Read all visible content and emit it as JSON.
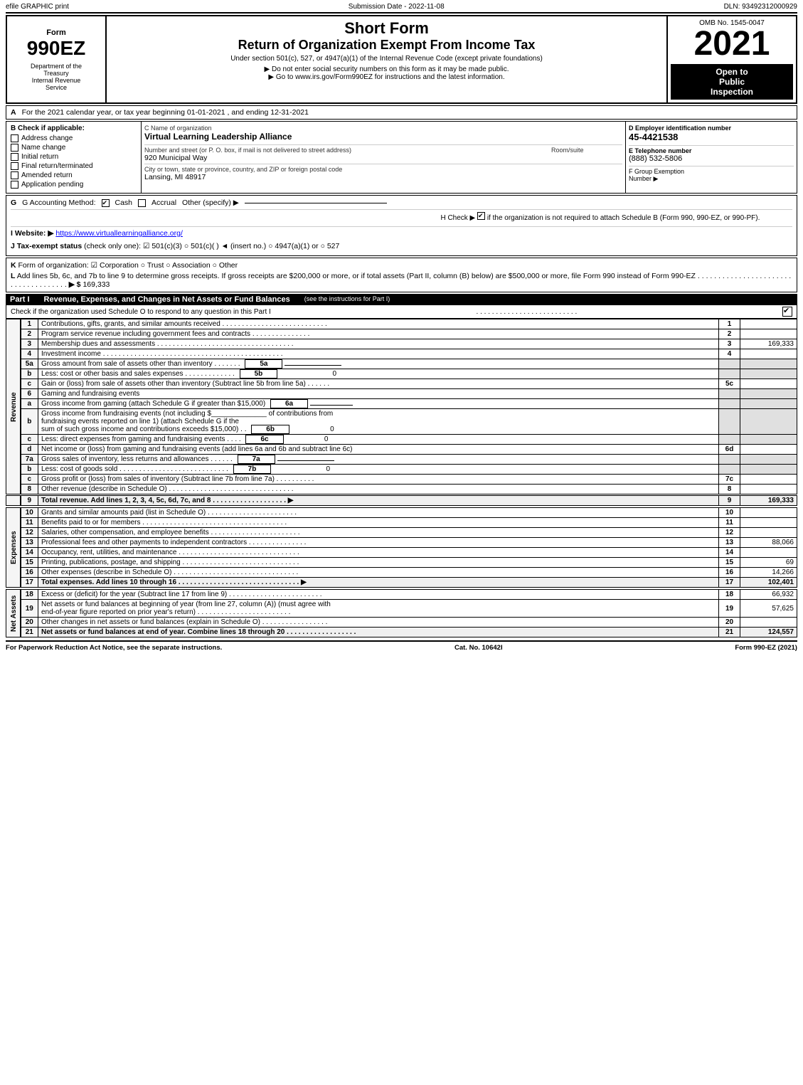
{
  "topBar": {
    "left": "efile GRAPHIC print",
    "mid": "Submission Date - 2022-11-08",
    "right": "DLN: 93492312000929"
  },
  "header": {
    "formNumber": "990EZ",
    "deptLine1": "Department of the",
    "deptLine2": "Treasury",
    "deptLine3": "Internal Revenue",
    "deptLine4": "Service",
    "shortForm": "Short Form",
    "returnTitle": "Return of Organization Exempt From Income Tax",
    "subText": "Under section 501(c), 527, or 4947(a)(1) of the Internal Revenue Code (except private foundations)",
    "noSSN": "▶ Do not enter social security numbers on this form as it may be made public.",
    "goTo": "▶ Go to www.irs.gov/Form990EZ for instructions and the latest information.",
    "ombNo": "OMB No. 1545-0047",
    "year": "2021",
    "openPublicLine1": "Open to",
    "openPublicLine2": "Public",
    "openPublicLine3": "Inspection"
  },
  "sectionA": {
    "label": "A",
    "text": "For the 2021 calendar year, or tax year beginning 01-01-2021 , and ending 12-31-2021"
  },
  "sectionB": {
    "label": "B",
    "checkTitle": "Check if applicable:",
    "items": [
      {
        "id": "address-change",
        "label": "Address change",
        "checked": false
      },
      {
        "id": "name-change",
        "label": "Name change",
        "checked": false
      },
      {
        "id": "initial-return",
        "label": "Initial return",
        "checked": false
      },
      {
        "id": "final-return",
        "label": "Final return/terminated",
        "checked": false
      },
      {
        "id": "amended-return",
        "label": "Amended return",
        "checked": false
      },
      {
        "id": "app-pending",
        "label": "Application pending",
        "checked": false
      }
    ]
  },
  "orgInfo": {
    "nameLabel": "C Name of organization",
    "name": "Virtual Learning Leadership Alliance",
    "streetLabel": "Number and street (or P. O. box, if mail is not delivered to street address)",
    "street": "920 Municipal Way",
    "roomLabel": "Room/suite",
    "room": "",
    "cityLabel": "City or town, state or province, country, and ZIP or foreign postal code",
    "city": "Lansing, MI  48917"
  },
  "taxInfo": {
    "einLabel": "D Employer identification number",
    "ein": "45-4421538",
    "phoneLabel": "E Telephone number",
    "phone": "(888) 532-5806",
    "fgroupLabel": "F Group Exemption",
    "fgroupLabel2": "Number",
    "fgroupArrow": "▶"
  },
  "accounting": {
    "gLabel": "G Accounting Method:",
    "cashLabel": "Cash",
    "cashChecked": true,
    "accrualLabel": "Accrual",
    "accrualChecked": false,
    "otherLabel": "Other (specify) ▶",
    "hLabel": "H Check ▶",
    "hText": "if the organization is not required to attach Schedule B (Form 990, 990-EZ, or 990-PF).",
    "hChecked": true,
    "iLabel": "I Website: ▶",
    "iValue": "https://www.virtuallearningalliance.org/",
    "jLabel": "J Tax-exempt status",
    "jText": "(check only one):",
    "j501c3": "✔ 501(c)(3)",
    "j501c": "○ 501(c)(   ) ◄ (insert no.)",
    "j4947": "○ 4947(a)(1) or",
    "j527": "○ 527"
  },
  "kSection": {
    "kLabel": "K",
    "kText": "Form of organization:",
    "corporation": "✔ Corporation",
    "trust": "○ Trust",
    "association": "○ Association",
    "other": "○ Other"
  },
  "lSection": {
    "lLabel": "L",
    "lText": "Add lines 5b, 6c, and 7b to line 9 to determine gross receipts. If gross receipts are $200,000 or more, or if total assets (Part II, column (B) below) are $500,000 or more, file Form 990 instead of Form 990-EZ",
    "dots": ". . . . . . . . . . . . . . . . . . . . . . . . . . . . . . . . . . . .",
    "arrow": "▶ $",
    "value": "169,333"
  },
  "partI": {
    "label": "Part I",
    "title": "Revenue, Expenses, and Changes in Net Assets or Fund Balances",
    "seeInstructions": "(see the instructions for Part I)",
    "scheduleOText": "Check if the organization used Schedule O to respond to any question in this Part I",
    "scheduleODots": ". . . . . . . . . . . . . . . . . . . . . . . . . .",
    "scheduleOChecked": true
  },
  "revenueRows": [
    {
      "num": "1",
      "desc": "Contributions, gifts, grants, and similar amounts received",
      "dots": ". . . . . . . . . . . . . . . . . . . . . . . . . . .",
      "lineNum": "1",
      "value": ""
    },
    {
      "num": "2",
      "desc": "Program service revenue including government fees and contracts",
      "dots": ". . . . . . . . . . . . . . . .",
      "lineNum": "2",
      "value": ""
    },
    {
      "num": "3",
      "desc": "Membership dues and assessments",
      "dots": ". . . . . . . . . . . . . . . . . . . . . . . . . . . . . . . . . . .",
      "lineNum": "3",
      "value": "169,333"
    },
    {
      "num": "4",
      "desc": "Investment income",
      "dots": ". . . . . . . . . . . . . . . . . . . . . . . . . . . . . . . . . . . . . . . . . . . . .",
      "lineNum": "4",
      "value": ""
    },
    {
      "num": "5a",
      "desc": "Gross amount from sale of assets other than inventory",
      "dots": ". . . . . . . .",
      "subLabel": "5a",
      "subValue": "",
      "lineNum": "",
      "value": ""
    },
    {
      "num": "b",
      "desc": "Less: cost or other basis and sales expenses",
      "dots": ". . . . . . . . . . . . .",
      "subLabel": "5b",
      "subValue": "0",
      "lineNum": "",
      "value": ""
    },
    {
      "num": "c",
      "desc": "Gain or (loss) from sale of assets other than inventory (Subtract line 5b from line 5a)",
      "dots": ". . . . . .",
      "lineNum": "5c",
      "value": ""
    },
    {
      "num": "6",
      "desc": "Gaming and fundraising events",
      "dots": "",
      "lineNum": "",
      "value": ""
    },
    {
      "num": "a",
      "desc": "Gross income from gaming (attach Schedule G if greater than $15,000)",
      "subLabel": "6a",
      "subValue": "",
      "lineNum": "",
      "value": ""
    },
    {
      "num": "b",
      "desc": "Gross income from fundraising events (not including $_____________ of contributions from fundraising events reported on line 1) (attach Schedule G if the sum of such gross income and contributions exceeds $15,000)",
      "subLabel": "6b",
      "subValue": "0",
      "lineNum": "",
      "value": ""
    },
    {
      "num": "c",
      "desc": "Less: direct expenses from gaming and fundraising events",
      "dots": ". . . .",
      "subLabel": "6c",
      "subValue": "0",
      "lineNum": "",
      "value": ""
    },
    {
      "num": "d",
      "desc": "Net income or (loss) from gaming and fundraising events (add lines 6a and 6b and subtract line 6c)",
      "dots": "",
      "lineNum": "6d",
      "value": ""
    },
    {
      "num": "7a",
      "desc": "Gross sales of inventory, less returns and allowances",
      "dots": ". . . . . .",
      "subLabel": "7a",
      "subValue": "",
      "lineNum": "",
      "value": ""
    },
    {
      "num": "b",
      "desc": "Less: cost of goods sold",
      "dots": ". . . . . . . . . . . . . . . . . . . . . . . . . . . . .",
      "subLabel": "7b",
      "subValue": "0",
      "lineNum": "",
      "value": ""
    },
    {
      "num": "c",
      "desc": "Gross profit or (loss) from sales of inventory (Subtract line 7b from line 7a)",
      "dots": ". . . . . . . . . .",
      "lineNum": "7c",
      "value": ""
    },
    {
      "num": "8",
      "desc": "Other revenue (describe in Schedule O)",
      "dots": ". . . . . . . . . . . . . . . . . . . . . . . . . . . . . . . .",
      "lineNum": "8",
      "value": ""
    },
    {
      "num": "9",
      "desc": "Total revenue. Add lines 1, 2, 3, 4, 5c, 6d, 7c, and 8",
      "dots": ". . . . . . . . . . . . . . . . . . . .",
      "arrow": "▶",
      "lineNum": "9",
      "value": "169,333",
      "bold": true
    }
  ],
  "expenseRows": [
    {
      "num": "10",
      "desc": "Grants and similar amounts paid (list in Schedule O)",
      "dots": ". . . . . . . . . . . . . . . . . . . . . . . .",
      "lineNum": "10",
      "value": ""
    },
    {
      "num": "11",
      "desc": "Benefits paid to or for members",
      "dots": ". . . . . . . . . . . . . . . . . . . . . . . . . . . . . . . . . . . . .",
      "lineNum": "11",
      "value": ""
    },
    {
      "num": "12",
      "desc": "Salaries, other compensation, and employee benefits",
      "dots": ". . . . . . . . . . . . . . . . . . . . . . . .",
      "lineNum": "12",
      "value": ""
    },
    {
      "num": "13",
      "desc": "Professional fees and other payments to independent contractors",
      "dots": ". . . . . . . . . . . . . . .",
      "lineNum": "13",
      "value": "88,066"
    },
    {
      "num": "14",
      "desc": "Occupancy, rent, utilities, and maintenance",
      "dots": ". . . . . . . . . . . . . . . . . . . . . . . . . . . . . . . . .",
      "lineNum": "14",
      "value": ""
    },
    {
      "num": "15",
      "desc": "Printing, publications, postage, and shipping",
      "dots": ". . . . . . . . . . . . . . . . . . . . . . . . . . . . . . .",
      "lineNum": "15",
      "value": "69"
    },
    {
      "num": "16",
      "desc": "Other expenses (describe in Schedule O)",
      "dots": ". . . . . . . . . . . . . . . . . . . . . . . . . . . . . . . .",
      "lineNum": "16",
      "value": "14,266"
    },
    {
      "num": "17",
      "desc": "Total expenses. Add lines 10 through 16",
      "dots": ". . . . . . . . . . . . . . . . . . . . . . . . . . . . . . . .",
      "arrow": "▶",
      "lineNum": "17",
      "value": "102,401",
      "bold": true
    }
  ],
  "netAssetsRows": [
    {
      "num": "18",
      "desc": "Excess or (deficit) for the year (Subtract line 17 from line 9)",
      "dots": ". . . . . . . . . . . . . . . . . . . . . . . .",
      "lineNum": "18",
      "value": "66,932"
    },
    {
      "num": "19",
      "desc": "Net assets or fund balances at beginning of year (from line 27, column (A)) (must agree with end-of-year figure reported on prior year's return)",
      "dots": ". . . . . . . . . . . . . . . . . . . . . . . .",
      "lineNum": "19",
      "value": "57,625"
    },
    {
      "num": "20",
      "desc": "Other changes in net assets or fund balances (explain in Schedule O)",
      "dots": ". . . . . . . . . . . . . . . . . .",
      "lineNum": "20",
      "value": ""
    },
    {
      "num": "21",
      "desc": "Net assets or fund balances at end of year. Combine lines 18 through 20",
      "dots": ". . . . . . . . . . . . . . . . . . . .",
      "lineNum": "21",
      "value": "124,557",
      "bold": true
    }
  ],
  "footer": {
    "paperworkText": "For Paperwork Reduction Act Notice, see the separate instructions.",
    "catNo": "Cat. No. 10642I",
    "formRef": "Form 990-EZ (2021)"
  }
}
